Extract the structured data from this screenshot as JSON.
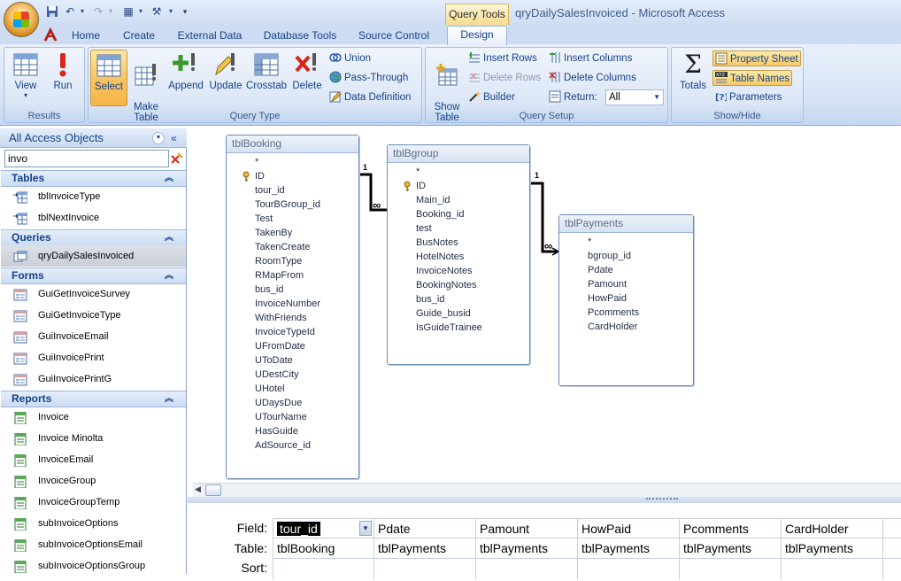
{
  "window": {
    "title": "qryDailySalesInvoiced - Microsoft Access",
    "contextual_tab": "Query Tools"
  },
  "tabs": [
    "Home",
    "Create",
    "External Data",
    "Database Tools",
    "Source Control",
    "Design"
  ],
  "ribbon": {
    "results": {
      "label": "Results",
      "view": "View",
      "run": "Run"
    },
    "query_type": {
      "label": "Query Type",
      "select": "Select",
      "make_table": "Make\nTable",
      "append": "Append",
      "update": "Update",
      "crosstab": "Crosstab",
      "delete": "Delete",
      "union": "Union",
      "pass_through": "Pass-Through",
      "data_definition": "Data Definition"
    },
    "query_setup": {
      "label": "Query Setup",
      "show_table": "Show\nTable",
      "insert_rows": "Insert Rows",
      "delete_rows": "Delete Rows",
      "builder": "Builder",
      "insert_columns": "Insert Columns",
      "delete_columns": "Delete Columns",
      "return_label": "Return:",
      "return_value": "All"
    },
    "show_hide": {
      "label": "Show/Hide",
      "totals": "Totals",
      "property_sheet": "Property Sheet",
      "table_names": "Table Names",
      "parameters": "Parameters"
    }
  },
  "nav": {
    "header": "All Access Objects",
    "search_value": "invo",
    "categories": [
      {
        "name": "Tables",
        "items": [
          "tblInvoiceType",
          "tblNextInvoice"
        ]
      },
      {
        "name": "Queries",
        "items": [
          "qryDailySalesInvoiced"
        ]
      },
      {
        "name": "Forms",
        "items": [
          "GuiGetInvoiceSurvey",
          "GuiGetInvoiceType",
          "GuiInvoiceEmail",
          "GuiInvoicePrint",
          "GuiInvoicePrintG"
        ]
      },
      {
        "name": "Reports",
        "items": [
          "Invoice",
          "Invoice Minolta",
          "InvoiceEmail",
          "InvoiceGroup",
          "InvoiceGroupTemp",
          "subInvoiceOptions",
          "subInvoiceOptionsEmail",
          "subInvoiceOptionsGroup"
        ]
      }
    ]
  },
  "tables": {
    "booking": {
      "name": "tblBooking",
      "fields": [
        "*",
        "ID",
        "tour_id",
        "TourBGroup_id",
        "Test",
        "TakenBy",
        "TakenCreate",
        "RoomType",
        "RMapFrom",
        "bus_id",
        "InvoiceNumber",
        "WithFriends",
        "InvoiceTypeId",
        "UFromDate",
        "UToDate",
        "UDestCity",
        "UHotel",
        "UDaysDue",
        "UTourName",
        "HasGuide",
        "AdSource_id"
      ]
    },
    "bgroup": {
      "name": "tblBgroup",
      "fields": [
        "*",
        "ID",
        "Main_id",
        "Booking_id",
        "test",
        "BusNotes",
        "HotelNotes",
        "InvoiceNotes",
        "BookingNotes",
        "bus_id",
        "Guide_busid",
        "IsGuideTrainee"
      ]
    },
    "payments": {
      "name": "tblPayments",
      "fields": [
        "*",
        "bgroup_id",
        "Pdate",
        "Pamount",
        "HowPaid",
        "Pcomments",
        "CardHolder"
      ]
    }
  },
  "relationships": [
    {
      "one": "1",
      "many": "∞"
    },
    {
      "one": "1",
      "many": "∞"
    }
  ],
  "grid": {
    "row_labels": [
      "Field:",
      "Table:",
      "Sort:"
    ],
    "columns": [
      {
        "field": "tour_id",
        "table": "tblBooking"
      },
      {
        "field": "Pdate",
        "table": "tblPayments"
      },
      {
        "field": "Pamount",
        "table": "tblPayments"
      },
      {
        "field": "HowPaid",
        "table": "tblPayments"
      },
      {
        "field": "Pcomments",
        "table": "tblPayments"
      },
      {
        "field": "CardHolder",
        "table": "tblPayments"
      }
    ]
  }
}
